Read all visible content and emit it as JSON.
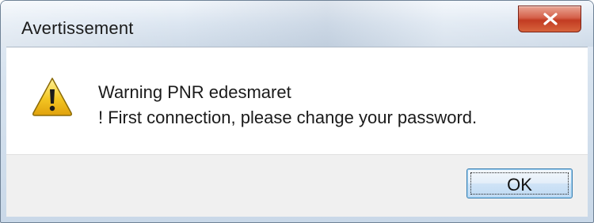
{
  "window": {
    "title": "Avertissement"
  },
  "title_bar": {
    "close_icon": "close-x-icon",
    "close_color": "#c23b22"
  },
  "message": {
    "icon": "warning-triangle-icon",
    "line1": "Warning PNR edesmaret",
    "line2": "! First connection, please change your password."
  },
  "buttons": {
    "ok_label": "OK"
  },
  "colors": {
    "warning_yellow": "#f3c623",
    "ok_border": "#3c7fb1"
  }
}
